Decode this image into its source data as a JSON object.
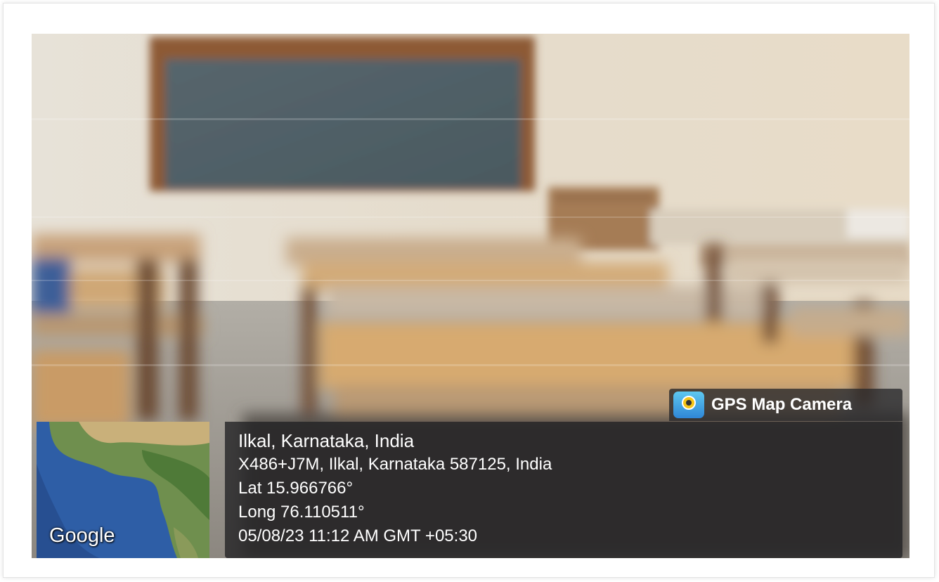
{
  "brand": {
    "label": "GPS Map Camera",
    "icon": "gps-map-camera-app-icon"
  },
  "minimap": {
    "attribution": "Google"
  },
  "location": {
    "place": "Ilkal, Karnataka, India",
    "address": "X486+J7M, Ilkal, Karnataka 587125, India",
    "latitude": "Lat 15.966766°",
    "longitude": "Long 76.110511°",
    "timestamp": "05/08/23 11:12 AM GMT +05:30"
  },
  "colors": {
    "overlay": "#202022",
    "text": "#ffffff",
    "wall": "#e6ddd0",
    "chalkboard": "#4f5f66",
    "desk": "#c9a070"
  }
}
